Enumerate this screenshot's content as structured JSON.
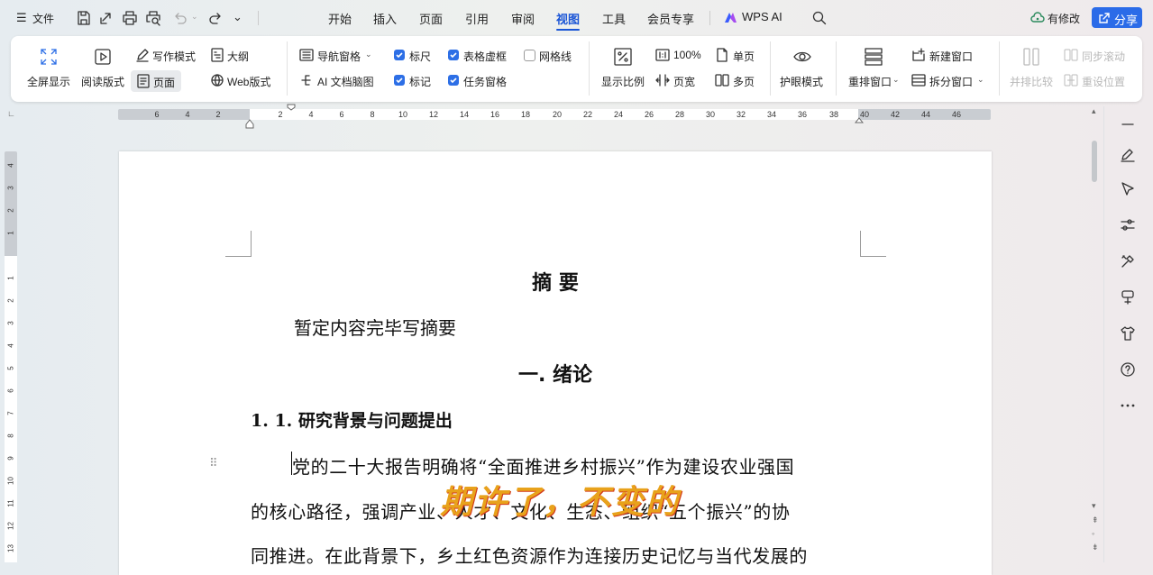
{
  "titlebar": {
    "menu_label": "文件",
    "tabs": [
      "开始",
      "插入",
      "页面",
      "引用",
      "审阅",
      "视图",
      "工具",
      "会员专享"
    ],
    "active_tab": "视图",
    "wps_ai_label": "WPS AI",
    "status_label": "有修改",
    "share_label": "分享"
  },
  "ribbon": {
    "fullscreen": "全屏显示",
    "reading_mode": "阅读版式",
    "writing_mode": "写作模式",
    "page_mode": "页面",
    "outline": "大纲",
    "web_layout": "Web版式",
    "nav_pane": "导航窗格",
    "ai_mindmap": "AI 文档脑图",
    "ruler": "标尺",
    "marks": "标记",
    "table_gridlines": "表格虚框",
    "task_pane": "任务窗格",
    "gridlines": "网格线",
    "zoom": "显示比例",
    "zoom_100": "100%",
    "page_width": "页宽",
    "single_page": "单页",
    "multi_page": "多页",
    "eye_care": "护眼模式",
    "rearrange": "重排窗口",
    "new_window": "新建窗口",
    "split_window": "拆分窗口",
    "side_by_side": "并排比较",
    "sync_scroll": "同步滚动",
    "reset_position": "重设位置",
    "checkbox_states": {
      "ruler": true,
      "marks": true,
      "table_gridlines": true,
      "task_pane": true,
      "gridlines": false
    }
  },
  "ruler": {
    "h_left": [
      "6",
      "4",
      "2"
    ],
    "h_right": [
      "2",
      "4",
      "6",
      "8",
      "10",
      "12",
      "14",
      "16",
      "18",
      "20",
      "22",
      "24",
      "26",
      "28",
      "30",
      "32",
      "34",
      "36",
      "38",
      "40",
      "42",
      "44",
      "46"
    ],
    "v_top": [
      "4",
      "3",
      "2",
      "1"
    ],
    "v_bottom": [
      "1",
      "2",
      "3",
      "4",
      "5",
      "6",
      "7",
      "8",
      "9",
      "10",
      "11",
      "12",
      "13"
    ]
  },
  "document": {
    "title": "摘 要",
    "abstract_text": "暂定内容完毕写摘要",
    "heading1": "一. 绪论",
    "heading2": "1. 1. 研究背景与问题提出",
    "para_line1": "党的二十大报告明确将“全面推进乡村振兴”作为建设农业强国",
    "para_line2": "的核心路径，强调产业、人才、文化、生态、组织“五个振兴”的协",
    "para_line3": "同推进。在此背景下，乡土红色资源作为连接历史记忆与当代发展的",
    "watermark": "期许了，不变的"
  },
  "colors": {
    "accent": "#1a55d6",
    "share_bg": "#2b6be8",
    "watermark_orange": "#e8a21b",
    "watermark_red": "#d23a1c"
  }
}
